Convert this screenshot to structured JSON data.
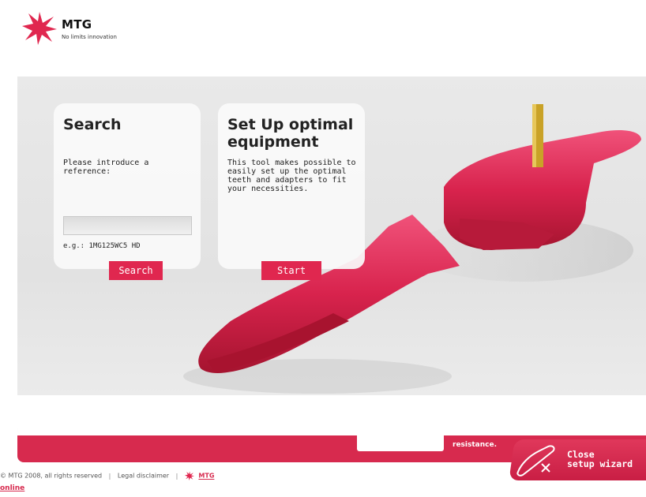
{
  "brand": {
    "name": "MTG",
    "tagline": "No limits innovation"
  },
  "search": {
    "title": "Search",
    "prompt": "Please introduce a reference:",
    "input_value": "",
    "example": "e.g.: 1MG125WC5 HD",
    "button_label": "Search"
  },
  "setup": {
    "title": "Set Up optimal equipment",
    "description": "This tool makes possible to easily set up the optimal teeth and adapters to fit your necessities.",
    "button_label": "Start"
  },
  "footer": {
    "tagline_fragment": "resistance.",
    "close_label_line1": "Close",
    "close_label_line2": "setup wizard",
    "copyright": "© MTG 2008, all rights reserved",
    "legal": "Legal disclaimer",
    "mtg_link": "MTG",
    "online": "online"
  },
  "colors": {
    "accent": "#d72a4e",
    "stage": "#e6e6e6"
  }
}
